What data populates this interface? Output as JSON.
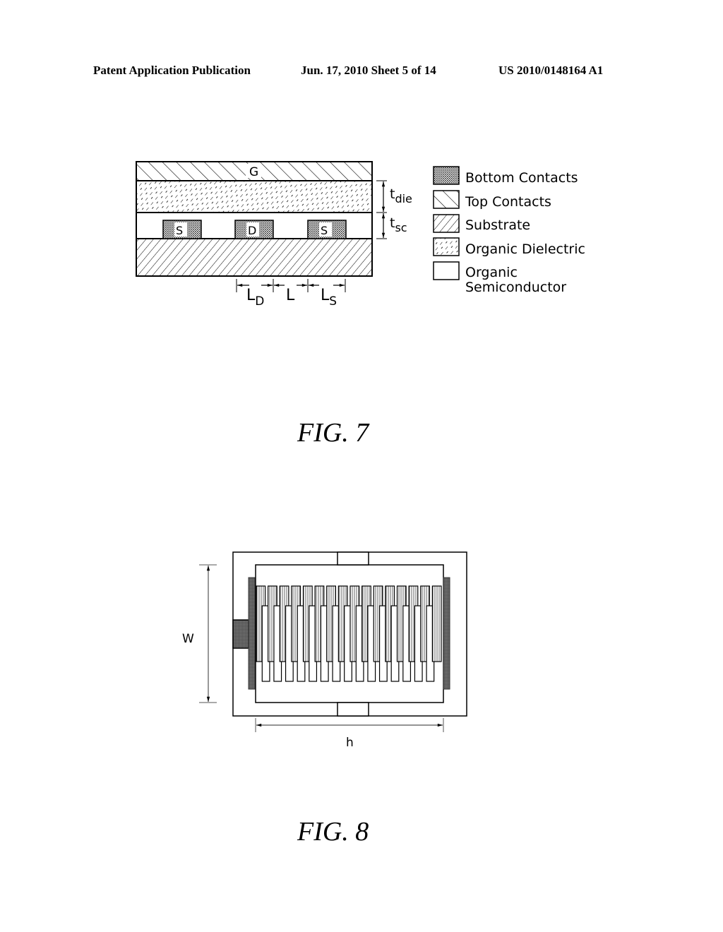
{
  "header": {
    "publication": "Patent Application Publication",
    "date_sheet": "Jun. 17, 2010  Sheet 5 of 14",
    "number": "US 2010/0148164 A1"
  },
  "fig7": {
    "caption": "FIG.  7",
    "gate_label": "G",
    "contacts": [
      "S",
      "D",
      "S"
    ],
    "dimensions": {
      "t_die": {
        "main": "t",
        "sub": "die"
      },
      "t_sc": {
        "main": "t",
        "sub": "sc"
      },
      "L_D": {
        "main": "L",
        "sub": "D"
      },
      "L": {
        "main": "L",
        "sub": ""
      },
      "L_S": {
        "main": "L",
        "sub": "S"
      }
    },
    "legend": [
      {
        "pattern": "crosshatch",
        "label": "Bottom Contacts"
      },
      {
        "pattern": "backslash-hatch",
        "label": "Top Contacts"
      },
      {
        "pattern": "slash-hatch",
        "label": "Substrate"
      },
      {
        "pattern": "dashed-hatch",
        "label": "Organic Dielectric"
      },
      {
        "pattern": "blank",
        "label": "Organic",
        "label2": "Semiconductor"
      }
    ]
  },
  "fig8": {
    "caption": "FIG.  8",
    "width_label": "W",
    "length_label": "h",
    "finger_count": 16
  }
}
